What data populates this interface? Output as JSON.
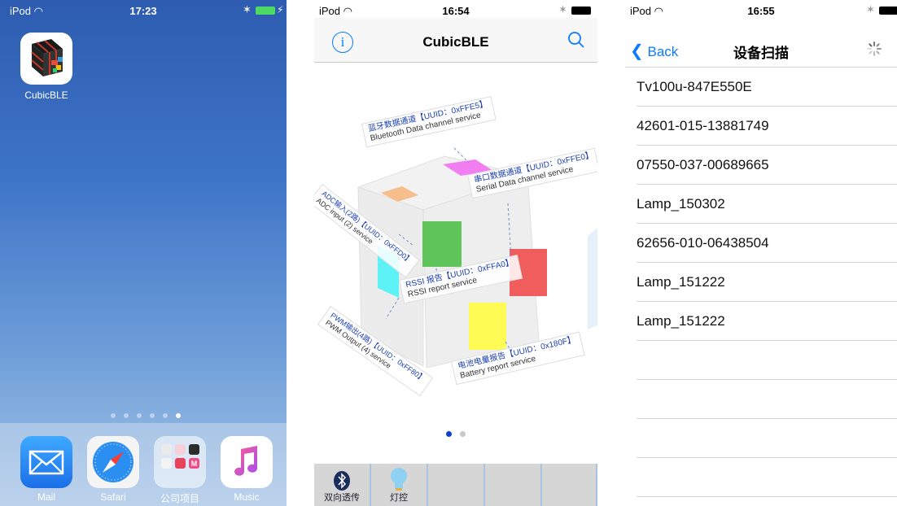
{
  "home": {
    "status": {
      "carrier": "iPod",
      "time": "17:23"
    },
    "app": {
      "label": "CubicBLE"
    },
    "page_dots": 6,
    "active_dot": 5,
    "dock": [
      {
        "label": "Mail"
      },
      {
        "label": "Safari"
      },
      {
        "label": "公司项目"
      },
      {
        "label": "Music"
      }
    ]
  },
  "cubic": {
    "status": {
      "carrier": "iPod",
      "time": "16:54"
    },
    "title": "CubicBLE",
    "annotations": {
      "bluetooth_cn": "蓝牙数据通道【UUID：0xFFE5】",
      "bluetooth_en": "Bluetooth Data channel service",
      "serial_cn": "串口数据通道【UUID：0xFFE0】",
      "serial_en": "Serial Data channel service",
      "adc_cn": "ADC输入(2路)【UUID：0xFFD0】",
      "adc_en": "ADC input (2) service",
      "rssi_cn": "RSSI 报告【UUID：0xFFA0】",
      "rssi_en": "RSSI report service",
      "pwm_cn": "PWM输出(4路)【UUID：0xFF80】",
      "pwm_en": "PWM Output (4) service",
      "battery_cn": "电池电量报告【UUID：0x180F】",
      "battery_en": "Battery report service"
    },
    "tabs": [
      {
        "label": "双向透传"
      },
      {
        "label": "灯控"
      }
    ]
  },
  "scan": {
    "status": {
      "carrier": "iPod",
      "time": "16:55"
    },
    "back_label": "Back",
    "title": "设备扫描",
    "devices": [
      "Tv100u-847E550E",
      "42601-015-13881749",
      "07550-037-00689665",
      "Lamp_150302",
      "62656-010-06438504",
      "Lamp_151222",
      "Lamp_151222"
    ]
  },
  "colors": {
    "ios_blue": "#0a7bff",
    "cube_green": "#5fc55a",
    "cube_red": "#ef5d5d",
    "cube_yellow": "#fffb55",
    "cube_cyan": "#5df2f5",
    "cube_orange": "#f6bd8d",
    "cube_pink": "#f27ff2"
  }
}
